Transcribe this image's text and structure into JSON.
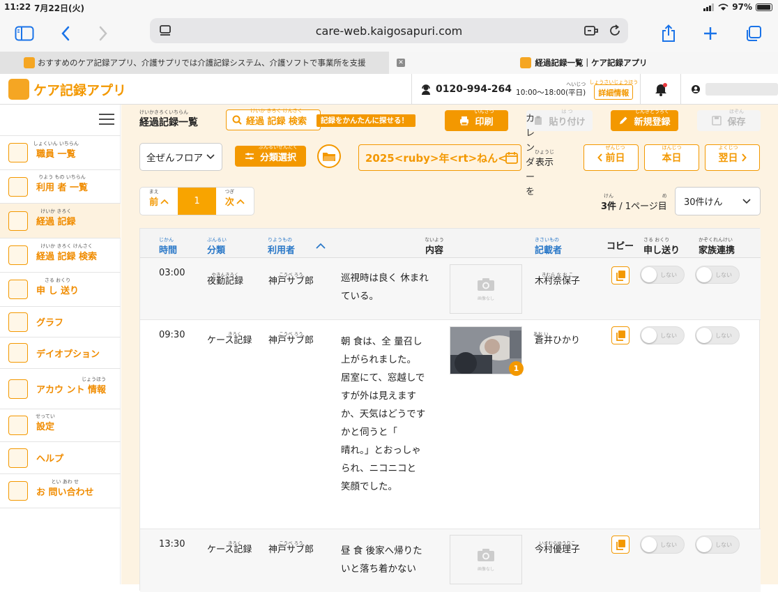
{
  "status": {
    "time": "11:22",
    "date": "7月22日(火)",
    "battery_pct": "97%",
    "battery_level": 0.97
  },
  "browser": {
    "url": "care-web.kaigosapuri.com"
  },
  "tabs": [
    {
      "title": "おすすめのケア記録アプリ、介護サプリでは介護記録システム、介護ソフトで事業所を支援"
    },
    {
      "title": "経過記録一覧｜ケア記録アプリ"
    }
  ],
  "header": {
    "app_name": "ケア記録アプリ",
    "phone": "0120-994-264",
    "hours": "10:00〜18:00(平日)",
    "hours_ruby": "へいじつ",
    "detail_label": "詳細情報",
    "detail_ruby": "しょうさいじょうほう"
  },
  "sidebar": {
    "items": [
      {
        "label": "職員 一覧",
        "ruby": "しょくいん いちらん"
      },
      {
        "label": "利用 者 一覧",
        "ruby": "りよう もの いちらん"
      },
      {
        "label": "経過 記録",
        "ruby": "けいか きろく"
      },
      {
        "label": "経過 記録 検索",
        "ruby": "けいか きろく けんさく"
      },
      {
        "label": "申 し 送り",
        "ruby": "さる おくり"
      },
      {
        "label": "グラフ",
        "ruby": ""
      },
      {
        "label": "デイオプション",
        "ruby": ""
      },
      {
        "label": "アカウ ント 情報",
        "ruby": "じょうほう"
      },
      {
        "label": "設定",
        "ruby": "せってい"
      },
      {
        "label": "ヘルプ",
        "ruby": ""
      },
      {
        "label": "お 問い合わせ",
        "ruby": "とい あわ せ"
      }
    ]
  },
  "page": {
    "title": "経過記録一覧",
    "title_ruby": "けいかきろくいちらん",
    "search_label": "経過 記録 検索",
    "search_ruby": "けいか きろく けんさく",
    "tooltip": "記録をかんたんに探せる！",
    "print_label": "印刷",
    "print_ruby": "いんさつ",
    "paste_label": "貼り付け",
    "paste_ruby": "は つ",
    "new_label": "新規登録",
    "new_ruby": "しんきとうろく",
    "save_label": "保存",
    "save_ruby": "ほぞん",
    "floor_select": "全ぜんフロア",
    "category_select": "分類選択",
    "category_ruby": "ぶんるいせんたく",
    "date_field": "2025<ruby>年<rt>ねん<",
    "calendar_vertical": "カレンダーを",
    "calendar_show": "表示",
    "calendar_show_ruby": "ひょうじ",
    "prev_day": "前日",
    "prev_day_ruby": "ぜんじつ",
    "today": "本日",
    "today_ruby": "ほんじつ",
    "next_day": "翌日",
    "next_day_ruby": "よくじつ",
    "pager_prev": "前",
    "pager_prev_ruby": "まえ",
    "pager_current": "1",
    "pager_next": "次",
    "pager_next_ruby": "つぎ",
    "count_number": "3件",
    "count_ruby": "けん",
    "page_info": "/ 1ページ目",
    "page_info_ruby": "め",
    "per_page": "30件けん"
  },
  "table": {
    "columns": [
      {
        "label": "時間",
        "ruby": "じかん"
      },
      {
        "label": "分類",
        "ruby": "ぶんるい"
      },
      {
        "label": "利用者",
        "ruby": "りようもの"
      },
      {
        "label": "内容",
        "ruby": "ないよう"
      },
      {
        "label": "記載者",
        "ruby": "きさいもの"
      },
      {
        "label": "コピー",
        "ruby": ""
      },
      {
        "label": "申し送り",
        "ruby": "さる おくり"
      },
      {
        "label": "家族連携",
        "ruby": "かぞくれんけい"
      }
    ],
    "no_image": "画像なし",
    "toggle_label": "しない",
    "rows": [
      {
        "time": "03:00",
        "category": "夜勤記録",
        "category_ruby": "やきんきろく",
        "user": "神戸サブ郎",
        "user_ruby": "こうべ ろう",
        "content": "巡視時は良く 休まれ\nている。",
        "writer": "木村奈保子",
        "writer_ruby": "きむら な お こ",
        "photo": "none"
      },
      {
        "time": "09:30",
        "category": "ケース記録",
        "category_ruby": "きろく",
        "user": "神戸サブ郎",
        "user_ruby": "こうべ ろう",
        "content": "朝 食は、全 量召し\n上がられました。\n居室にて、窓越しで\nすが外は見えます\nか、天気はどうです\nかと伺うと「\n晴れ。」とおっしゃ\nられ、ニコニコと\n笑顔でした。",
        "writer": "蒼井ひかり",
        "writer_ruby": "あお い",
        "photo": "photo",
        "photo_count": "1"
      },
      {
        "time": "13:30",
        "category": "ケース記録",
        "category_ruby": "きろく",
        "user": "神戸サブ郎",
        "user_ruby": "こうべ ろう",
        "content": "昼 食 後家へ帰りた\nいと落ち着かない",
        "writer": "今村優理子",
        "writer_ruby": "いまむらゆうりこ",
        "photo": "none"
      }
    ]
  }
}
